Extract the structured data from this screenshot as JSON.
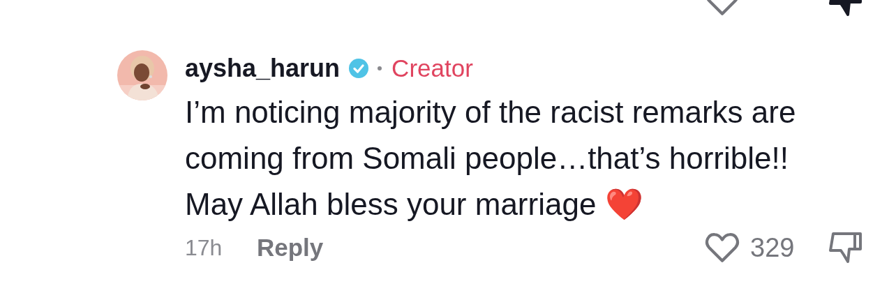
{
  "previous_comment": {
    "liked": false,
    "disliked": true
  },
  "comment": {
    "username": "aysha_harun",
    "verified": true,
    "badge": "Creator",
    "text": "I’m noticing majority of the racist remarks are coming from Somali people…that’s horrible!! May Allah bless your marriage ❤️",
    "time": "17h",
    "reply": "Reply",
    "likes": "329",
    "liked": false,
    "disliked": false
  }
}
